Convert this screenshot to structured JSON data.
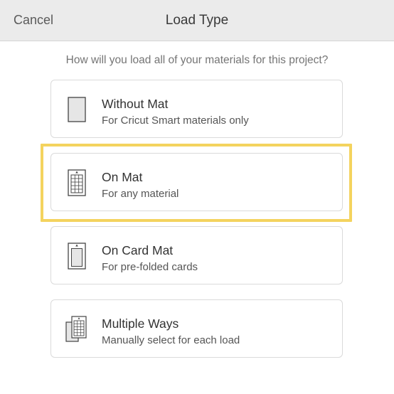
{
  "header": {
    "cancel_label": "Cancel",
    "title": "Load Type"
  },
  "prompt": "How will you load all of your materials for this project?",
  "options": [
    {
      "label": "Without Mat",
      "sub": "For Cricut Smart materials only",
      "icon": "blank-material-icon"
    },
    {
      "label": "On Mat",
      "sub": "For any material",
      "icon": "cutting-mat-icon",
      "selected": true
    },
    {
      "label": "On Card Mat",
      "sub": "For pre-folded cards",
      "icon": "card-mat-icon"
    },
    {
      "label": "Multiple Ways",
      "sub": "Manually select for each load",
      "icon": "multiple-mats-icon"
    }
  ],
  "colors": {
    "highlight": "#f4d35e",
    "header_bg": "#ebebeb"
  }
}
